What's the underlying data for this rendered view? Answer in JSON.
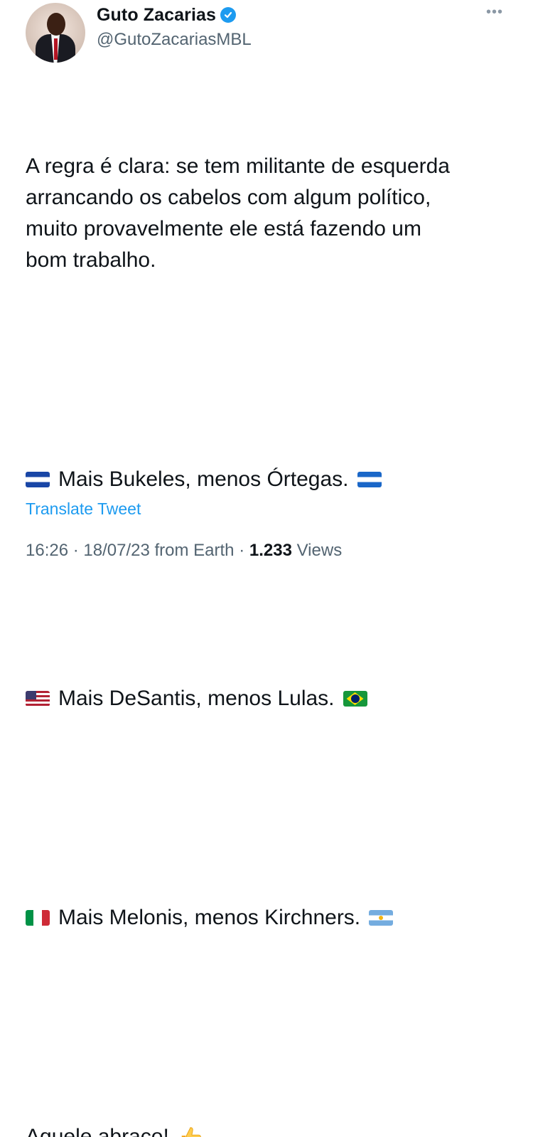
{
  "author": {
    "name": "Guto Zacarias",
    "handle": "@GutoZacariasMBL",
    "verified": true,
    "avatar": "avatar-photo"
  },
  "menu": {
    "more_label": "•••"
  },
  "tweet": {
    "intro": "A regra é clara: se tem militante de esquerda arrancando os cabelos com algum político, muito provavelmente ele está fazendo um bom trabalho.",
    "lines": [
      {
        "text": "Mais Bukeles, menos Órtegas.",
        "flag_start": "el-salvador-flag",
        "flag_end": "nicaragua-flag"
      },
      {
        "text": "Mais DeSantis, menos Lulas.",
        "flag_start": "usa-flag",
        "flag_end": "brazil-flag"
      },
      {
        "text": "Mais Melonis, menos Kirchners.",
        "flag_start": "italy-flag",
        "flag_end": "argentina-flag"
      }
    ],
    "closing": "Aquele abraço!",
    "closing_emoji": "thumbs-up"
  },
  "translate_label": "Translate Tweet",
  "meta": {
    "time": "16:26",
    "date": "18/07/23",
    "source": "from Earth",
    "views_count": "1.233",
    "views_label": "Views"
  },
  "colors": {
    "accent": "#1d9bf0",
    "secondary_text": "#536471",
    "text": "#0f1419"
  }
}
